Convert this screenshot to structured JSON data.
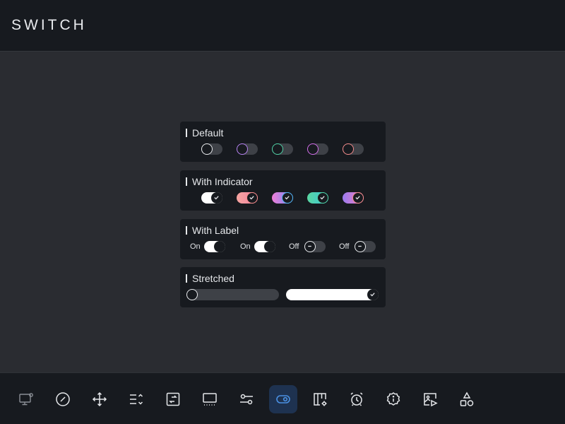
{
  "header": {
    "title": "SWITCH"
  },
  "sections": {
    "default": {
      "title": "Default",
      "switches": [
        {
          "state": "off",
          "knob_color": "#e8eaed",
          "track": "#3e4147"
        },
        {
          "state": "off",
          "knob_color": "#b480f0",
          "track": "#3e4147"
        },
        {
          "state": "off",
          "knob_color": "#4fd1a5",
          "track": "#3e4147"
        },
        {
          "state": "off",
          "knob_color": "#d06be8",
          "track": "#3e4147"
        },
        {
          "state": "off",
          "knob_color": "#f28a8a",
          "track": "#3e4147"
        }
      ]
    },
    "with_indicator": {
      "title": "With Indicator",
      "switches": [
        {
          "state": "on",
          "track": "#ffffff",
          "knob_color": "#e8eaed"
        },
        {
          "state": "on",
          "track": "linear-gradient(90deg,#f6a5a0,#f07ea0)",
          "knob_color": "#f28a8a"
        },
        {
          "state": "on",
          "track": "linear-gradient(90deg,#f07ed8,#6b8cf5)",
          "knob_color": "#4fb3f0"
        },
        {
          "state": "on",
          "track": "linear-gradient(90deg,#5ad7a0,#39c3e0)",
          "knob_color": "#4fd1a5"
        },
        {
          "state": "on",
          "track": "linear-gradient(90deg,#9b7cf0,#f07ec0)",
          "knob_color": "#f28a8a"
        }
      ]
    },
    "with_label": {
      "title": "With Label",
      "items": [
        {
          "label": "On",
          "state": "on"
        },
        {
          "label": "On",
          "state": "on"
        },
        {
          "label": "Off",
          "state": "off"
        },
        {
          "label": "Off",
          "state": "off"
        }
      ]
    },
    "stretched": {
      "title": "Stretched",
      "items": [
        {
          "state": "off"
        },
        {
          "state": "on"
        }
      ]
    }
  },
  "nav": {
    "items": [
      {
        "icon": "monitor-icon",
        "active": false
      },
      {
        "icon": "gauge-icon",
        "active": false
      },
      {
        "icon": "move-icon",
        "active": false
      },
      {
        "icon": "list-sort-icon",
        "active": false
      },
      {
        "icon": "swap-icon",
        "active": false
      },
      {
        "icon": "screen-icon",
        "active": false
      },
      {
        "icon": "sliders-icon",
        "active": false
      },
      {
        "icon": "toggle-icon",
        "active": true
      },
      {
        "icon": "columns-settings-icon",
        "active": false
      },
      {
        "icon": "alarm-icon",
        "active": false
      },
      {
        "icon": "info-badge-icon",
        "active": false
      },
      {
        "icon": "media-icon",
        "active": false
      },
      {
        "icon": "shapes-icon",
        "active": false
      }
    ]
  },
  "colors": {
    "background": "#2a2c31",
    "panel": "#171a1f",
    "active_nav": "#1e3250",
    "accent_blue": "#4a90e2"
  }
}
